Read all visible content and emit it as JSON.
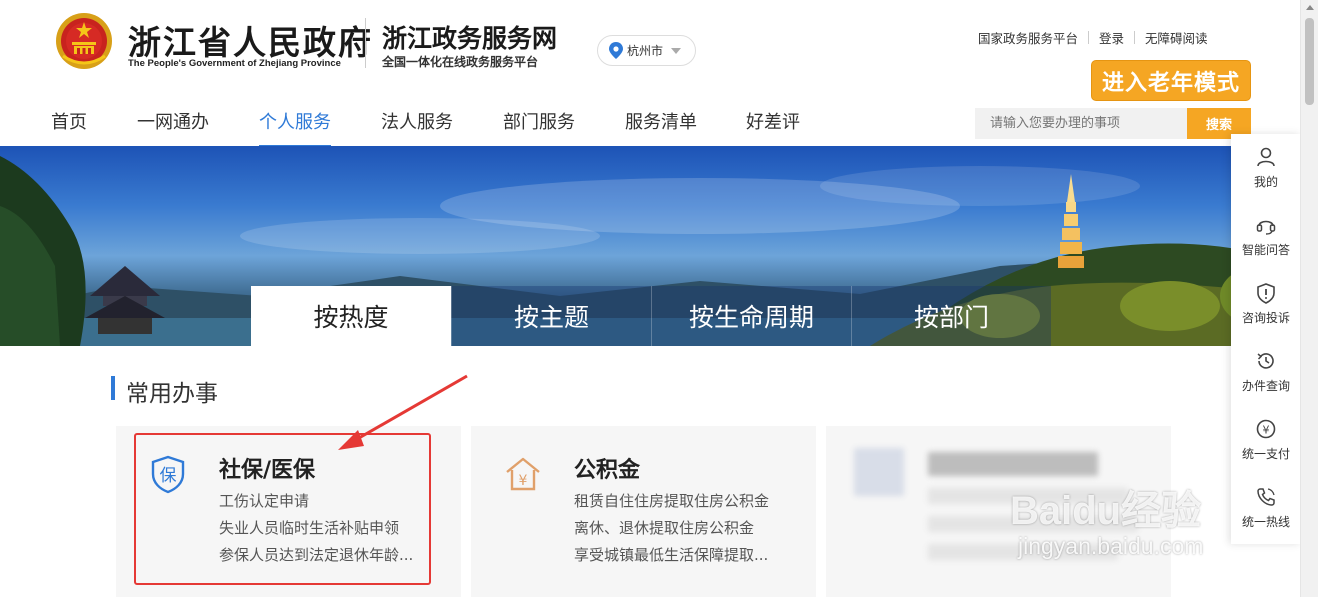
{
  "header": {
    "gov_title": "浙江省人民政府",
    "gov_subtitle": "The People's Government of Zhejiang Province",
    "site_title": "浙江政务服务网",
    "site_subtitle": "全国一体化在线政务服务平台",
    "city": "杭州市",
    "top_links": [
      "国家政务服务平台",
      "登录",
      "无障碍阅读"
    ],
    "elder_mode_button": "进入老年模式"
  },
  "nav": {
    "items": [
      "首页",
      "一网通办",
      "个人服务",
      "法人服务",
      "部门服务",
      "服务清单",
      "好差评"
    ],
    "active": "个人服务"
  },
  "search": {
    "placeholder": "请输入您要办理的事项",
    "button": "搜索"
  },
  "tabs": {
    "items": [
      "按热度",
      "按主题",
      "按生命周期",
      "按部门"
    ],
    "active": "按热度"
  },
  "section": {
    "title": "常用办事"
  },
  "cards": [
    {
      "icon": "shield-bao-icon",
      "title": "社保/医保",
      "lines": [
        "工伤认定申请",
        "失业人员临时生活补贴申领",
        "参保人员达到法定退休年龄..."
      ]
    },
    {
      "icon": "house-yuan-icon",
      "title": "公积金",
      "lines": [
        "租赁自住住房提取住房公积金",
        "离休、退休提取住房公积金",
        "享受城镇最低生活保障提取..."
      ]
    }
  ],
  "float_bar": {
    "items": [
      "我的",
      "智能问答",
      "咨询投诉",
      "办件查询",
      "统一支付",
      "统一热线"
    ]
  },
  "watermark": {
    "brand": "Baidu经验",
    "url": "jingyan.baidu.com"
  },
  "colors": {
    "accent_blue": "#2f7ad7",
    "accent_orange": "#f5a623",
    "highlight_red": "#e53935"
  }
}
